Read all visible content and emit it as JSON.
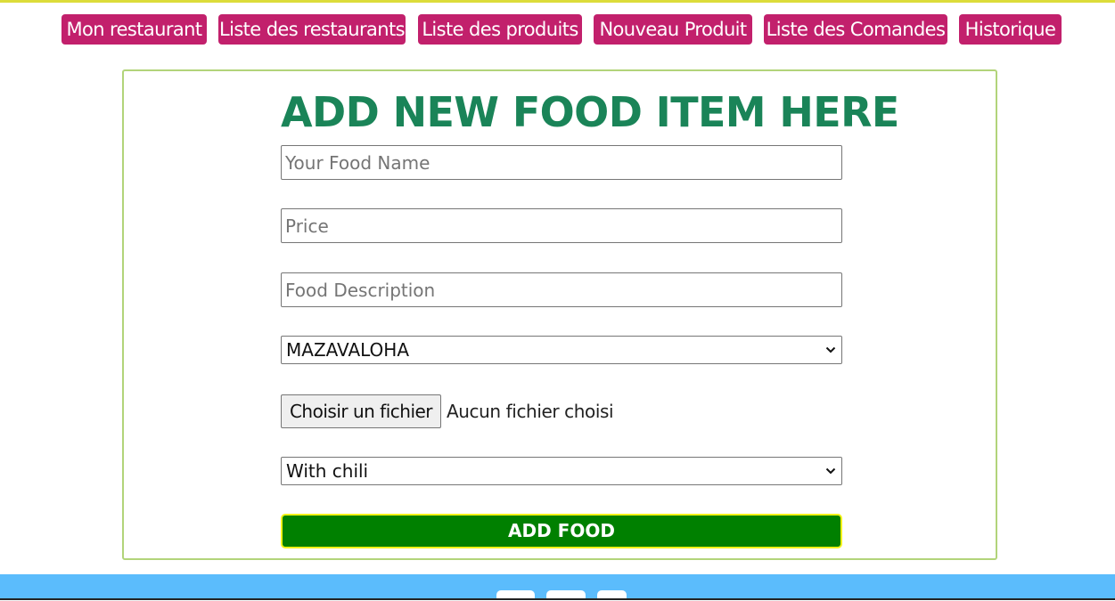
{
  "nav": {
    "items": [
      {
        "label": "Mon restaurant"
      },
      {
        "label": "Liste des restaurants"
      },
      {
        "label": "Liste des produits"
      },
      {
        "label": "Nouveau Produit"
      },
      {
        "label": "Liste des Comandes"
      },
      {
        "label": "Historique"
      }
    ]
  },
  "form": {
    "title": "ADD NEW FOOD ITEM HERE",
    "food_name": {
      "placeholder": "Your Food Name",
      "value": ""
    },
    "price": {
      "placeholder": "Price",
      "value": ""
    },
    "description": {
      "placeholder": "Food Description",
      "value": ""
    },
    "restaurant_select": {
      "selected": "MAZAVALOHA"
    },
    "file": {
      "button_label": "Choisir un fichier",
      "status": "Aucun fichier choisi"
    },
    "option_select": {
      "selected": "With chili"
    },
    "submit_label": "ADD FOOD"
  },
  "colors": {
    "nav_bg": "#c2206c",
    "title": "#1a8458",
    "card_border": "#b2d47a",
    "submit_bg": "#008000",
    "submit_border": "#f2f21a",
    "footer_bg": "#5bbcfc"
  },
  "icons": {
    "select_chevron": "chevron-down-icon"
  }
}
